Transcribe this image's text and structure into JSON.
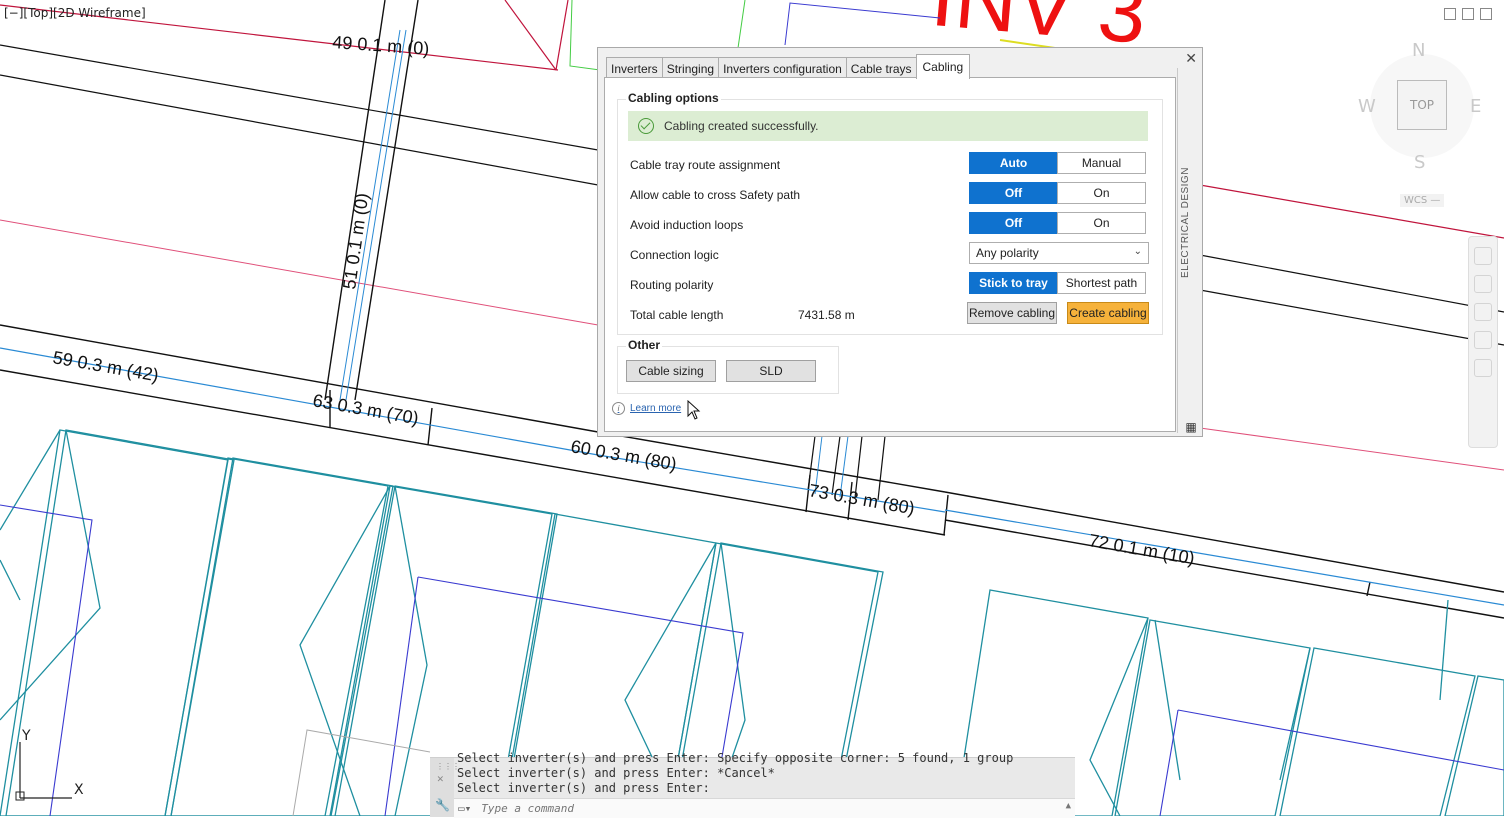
{
  "viewport": {
    "label": "[−][Top][2D Wireframe]",
    "big_label": "INV 3",
    "cad_labels": [
      "49  0.1 m  (0)",
      "51  0.1 m  (0)",
      "59  0.3 m  (42)",
      "63  0.3 m  (70)",
      "60  0.3 m  (80)",
      "73  0.3 m  (80)",
      "72  0.1 m  (10)"
    ]
  },
  "viewcube": {
    "north": "N",
    "south": "S",
    "east": "E",
    "west": "W",
    "top": "TOP",
    "wcs": "WCS —"
  },
  "palette": {
    "side_title": "ELECTRICAL DESIGN",
    "close_label": "✕",
    "tabs": [
      "Inverters",
      "Stringing",
      "Inverters configuration",
      "Cable trays",
      "Cabling"
    ],
    "active_tab": "Cabling",
    "cabling_options": {
      "title": "Cabling options",
      "success_message": "Cabling created successfully.",
      "route_assignment": {
        "label": "Cable tray route assignment",
        "options": [
          "Auto",
          "Manual"
        ],
        "selected": "Auto"
      },
      "cross_safety": {
        "label": "Allow cable to cross Safety path",
        "options": [
          "Off",
          "On"
        ],
        "selected": "Off"
      },
      "induction_loops": {
        "label": "Avoid induction loops",
        "options": [
          "Off",
          "On"
        ],
        "selected": "Off"
      },
      "connection_logic": {
        "label": "Connection logic",
        "value": "Any polarity"
      },
      "routing_polarity": {
        "label": "Routing polarity",
        "options": [
          "Stick to tray",
          "Shortest path"
        ],
        "selected": "Stick to tray"
      },
      "total_length": {
        "label": "Total cable length",
        "value": "7431.58 m"
      },
      "remove_button": "Remove cabling",
      "create_button": "Create cabling"
    },
    "other": {
      "title": "Other",
      "cable_sizing": "Cable sizing",
      "sld": "SLD"
    },
    "learn_more": "Learn more"
  },
  "command_line": {
    "history": [
      "Select inverter(s) and press Enter: Specify opposite corner: 5 found, 1 group",
      "Select inverter(s) and press Enter: *Cancel*",
      "Select inverter(s) and press Enter:"
    ],
    "placeholder": "Type a command"
  },
  "ucs": {
    "x": "X",
    "y": "Y"
  },
  "colors": {
    "accent_blue": "#0f72cf",
    "create_orange": "#f6b23b",
    "success_bg": "#dcedd3",
    "cad_cyan": "#1f8fa0",
    "cad_blue": "#3a3ad0",
    "cad_red": "#c0143c"
  }
}
